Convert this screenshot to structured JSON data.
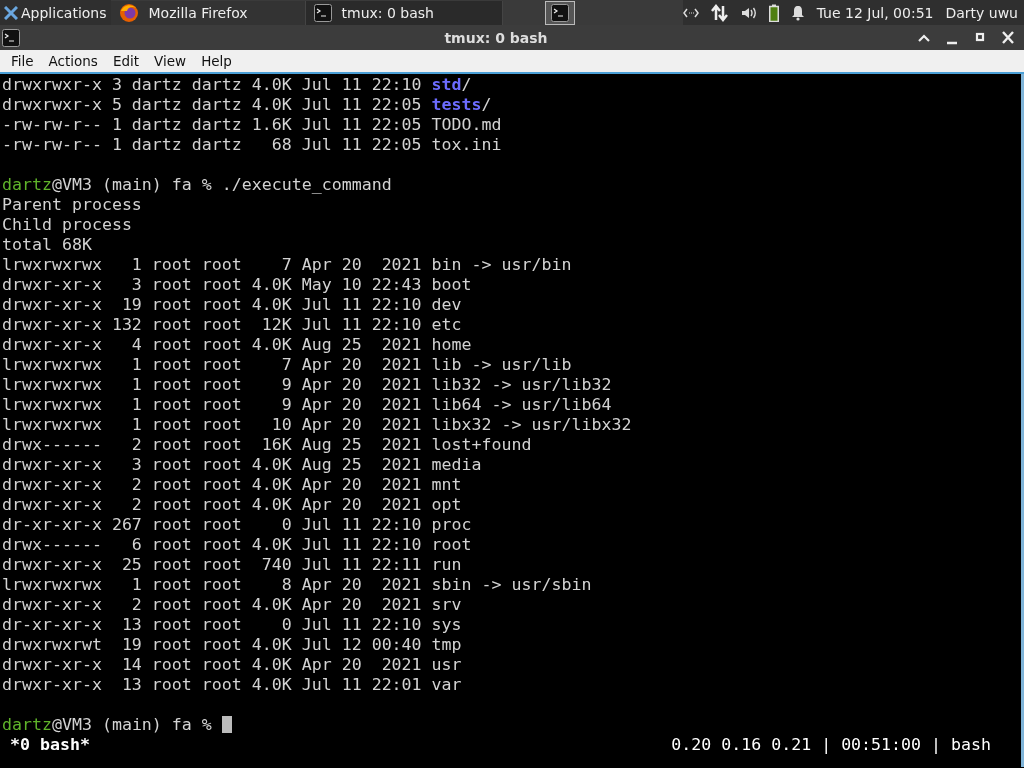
{
  "panel": {
    "applications": "Applications",
    "tasks": [
      {
        "label": "Mozilla Firefox",
        "kind": "browser",
        "selected": false
      },
      {
        "label": "tmux: 0 bash",
        "kind": "terminal",
        "selected": true
      }
    ],
    "clock": "Tue 12 Jul, 00:51",
    "user": "Darty uwu"
  },
  "window": {
    "title": "tmux: 0 bash"
  },
  "menu": [
    "File",
    "Actions",
    "Edit",
    "View",
    "Help"
  ],
  "terminal": {
    "lines": [
      [
        {
          "kind": "plain",
          "text": "drwxrwxr-x 3 dartz dartz 4.0K Jul 11 22:10 "
        },
        {
          "kind": "dir",
          "text": "std"
        },
        {
          "kind": "plain",
          "text": "/"
        }
      ],
      [
        {
          "kind": "plain",
          "text": "drwxrwxr-x 5 dartz dartz 4.0K Jul 11 22:05 "
        },
        {
          "kind": "dir",
          "text": "tests"
        },
        {
          "kind": "plain",
          "text": "/"
        }
      ],
      [
        {
          "kind": "plain",
          "text": "-rw-rw-r-- 1 dartz dartz 1.6K Jul 11 22:05 TODO.md"
        }
      ],
      [
        {
          "kind": "plain",
          "text": "-rw-rw-r-- 1 dartz dartz   68 Jul 11 22:05 tox.ini"
        }
      ],
      {
        "kind": "blank"
      },
      [
        {
          "kind": "user",
          "text": "dartz"
        },
        {
          "kind": "plain",
          "text": "@VM3 (main) fa % ./execute_command"
        }
      ],
      [
        {
          "kind": "plain",
          "text": "Parent process"
        }
      ],
      [
        {
          "kind": "plain",
          "text": "Child process"
        }
      ],
      [
        {
          "kind": "plain",
          "text": "total 68K"
        }
      ],
      [
        {
          "kind": "plain",
          "text": "lrwxrwxrwx   1 root root    7 Apr 20  2021 bin -> usr/bin"
        }
      ],
      [
        {
          "kind": "plain",
          "text": "drwxr-xr-x   3 root root 4.0K May 10 22:43 boot"
        }
      ],
      [
        {
          "kind": "plain",
          "text": "drwxr-xr-x  19 root root 4.0K Jul 11 22:10 dev"
        }
      ],
      [
        {
          "kind": "plain",
          "text": "drwxr-xr-x 132 root root  12K Jul 11 22:10 etc"
        }
      ],
      [
        {
          "kind": "plain",
          "text": "drwxr-xr-x   4 root root 4.0K Aug 25  2021 home"
        }
      ],
      [
        {
          "kind": "plain",
          "text": "lrwxrwxrwx   1 root root    7 Apr 20  2021 lib -> usr/lib"
        }
      ],
      [
        {
          "kind": "plain",
          "text": "lrwxrwxrwx   1 root root    9 Apr 20  2021 lib32 -> usr/lib32"
        }
      ],
      [
        {
          "kind": "plain",
          "text": "lrwxrwxrwx   1 root root    9 Apr 20  2021 lib64 -> usr/lib64"
        }
      ],
      [
        {
          "kind": "plain",
          "text": "lrwxrwxrwx   1 root root   10 Apr 20  2021 libx32 -> usr/libx32"
        }
      ],
      [
        {
          "kind": "plain",
          "text": "drwx------   2 root root  16K Aug 25  2021 lost+found"
        }
      ],
      [
        {
          "kind": "plain",
          "text": "drwxr-xr-x   3 root root 4.0K Aug 25  2021 media"
        }
      ],
      [
        {
          "kind": "plain",
          "text": "drwxr-xr-x   2 root root 4.0K Apr 20  2021 mnt"
        }
      ],
      [
        {
          "kind": "plain",
          "text": "drwxr-xr-x   2 root root 4.0K Apr 20  2021 opt"
        }
      ],
      [
        {
          "kind": "plain",
          "text": "dr-xr-xr-x 267 root root    0 Jul 11 22:10 proc"
        }
      ],
      [
        {
          "kind": "plain",
          "text": "drwx------   6 root root 4.0K Jul 11 22:10 root"
        }
      ],
      [
        {
          "kind": "plain",
          "text": "drwxr-xr-x  25 root root  740 Jul 11 22:11 run"
        }
      ],
      [
        {
          "kind": "plain",
          "text": "lrwxrwxrwx   1 root root    8 Apr 20  2021 sbin -> usr/sbin"
        }
      ],
      [
        {
          "kind": "plain",
          "text": "drwxr-xr-x   2 root root 4.0K Apr 20  2021 srv"
        }
      ],
      [
        {
          "kind": "plain",
          "text": "dr-xr-xr-x  13 root root    0 Jul 11 22:10 sys"
        }
      ],
      [
        {
          "kind": "plain",
          "text": "drwxrwxrwt  19 root root 4.0K Jul 12 00:40 tmp"
        }
      ],
      [
        {
          "kind": "plain",
          "text": "drwxr-xr-x  14 root root 4.0K Apr 20  2021 usr"
        }
      ],
      [
        {
          "kind": "plain",
          "text": "drwxr-xr-x  13 root root 4.0K Jul 11 22:01 var"
        }
      ],
      {
        "kind": "blank"
      },
      [
        {
          "kind": "user",
          "text": "dartz"
        },
        {
          "kind": "plain",
          "text": "@VM3 (main) fa % "
        },
        {
          "kind": "cursor"
        }
      ]
    ],
    "status_left": "*0 bash*",
    "status_right": "0.20 0.16 0.21 | 00:51:00 | bash"
  }
}
